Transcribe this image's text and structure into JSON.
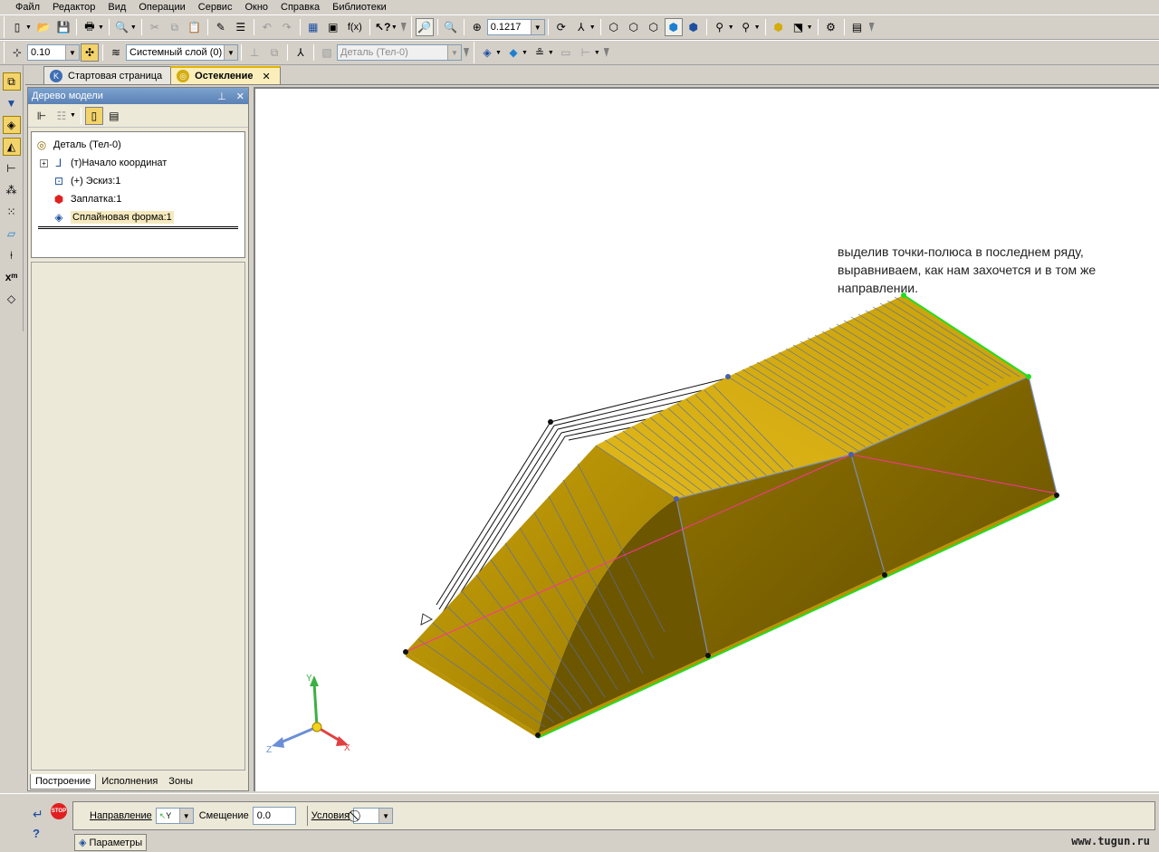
{
  "menu": [
    "Файл",
    "Редактор",
    "Вид",
    "Операции",
    "Сервис",
    "Окно",
    "Справка",
    "Библиотеки"
  ],
  "toolbar": {
    "zoom_value": "0.1217",
    "step_value": "0.10",
    "layer_value": "Системный слой (0)",
    "part_value": "Деталь (Тел-0)",
    "fx_label": "f(x)"
  },
  "tabs": [
    {
      "label": "Стартовая страница",
      "active": false
    },
    {
      "label": "Остекление",
      "active": true
    }
  ],
  "tree": {
    "title": "Дерево модели",
    "items": [
      {
        "label": "Деталь (Тел-0)",
        "icon": "part-icon"
      },
      {
        "label": "(т)Начало координат",
        "icon": "origin-icon"
      },
      {
        "label": "(+) Эскиз:1",
        "icon": "sketch-icon"
      },
      {
        "label": "Заплатка:1",
        "icon": "patch-icon"
      },
      {
        "label": "Сплайновая форма:1",
        "icon": "spline-form-icon"
      }
    ],
    "bottom_tabs": [
      "Построение",
      "Исполнения",
      "Зоны"
    ]
  },
  "annotation": [
    "выделив точки-полюса в последнем ряду,",
    "выравниваем, как нам захочется и в том же",
    "направлении."
  ],
  "axes": {
    "y": "Y",
    "z": "Z",
    "x": "X"
  },
  "params": {
    "direction_label": "Направление",
    "direction_value": "Y",
    "offset_label": "Смещение",
    "offset_value": "0.0",
    "conditions_label": "Условия",
    "tab_label": "Параметры",
    "stop_label": "STOP",
    "help_label": "?"
  },
  "watermark": "www.tugun.ru",
  "colors": {
    "surface": "#d4ac0d",
    "surface_dark": "#8a6e00",
    "control_line": "#5a6fa0",
    "highlight_points": "#22dd22",
    "pink_line": "#ff3399"
  }
}
